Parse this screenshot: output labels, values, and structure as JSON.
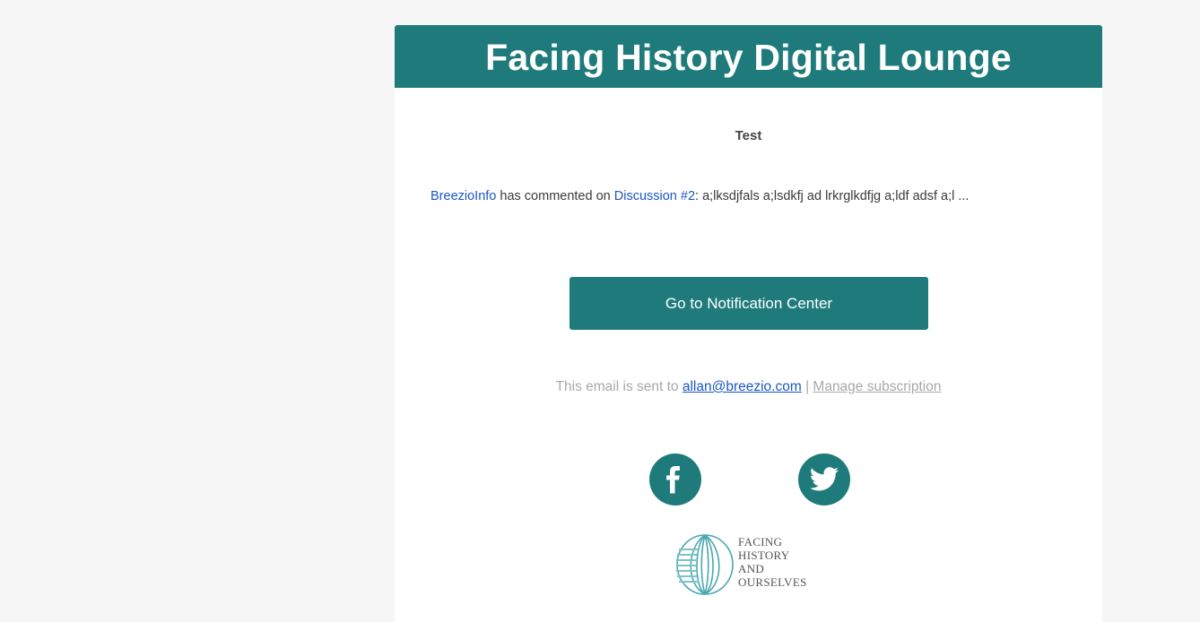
{
  "header": {
    "title": "Facing History Digital Lounge"
  },
  "email": {
    "subject": "Test",
    "message": {
      "actor": "BreezioInfo",
      "verb": " has commented on ",
      "target": "Discussion #2",
      "body": ": a;lksdjfals a;lsdkfj ad lrkrglkdfjg a;ldf adsf a;l ..."
    },
    "cta_label": "Go to Notification Center"
  },
  "footer": {
    "sent_prefix": "This email is sent to ",
    "recipient": "allan@breezio.com",
    "separator": " | ",
    "manage_label": "Manage subscription"
  },
  "social": [
    {
      "icon": "facebook-icon"
    },
    {
      "icon": "twitter-icon"
    }
  ],
  "logo": {
    "lines": [
      "FACING",
      "HISTORY",
      "AND",
      "OURSELVES"
    ]
  },
  "colors": {
    "brand": "#1f7b7b",
    "link": "#1a56c4",
    "page_bg": "#f6f6f6",
    "muted_text": "#a8a8a8"
  }
}
